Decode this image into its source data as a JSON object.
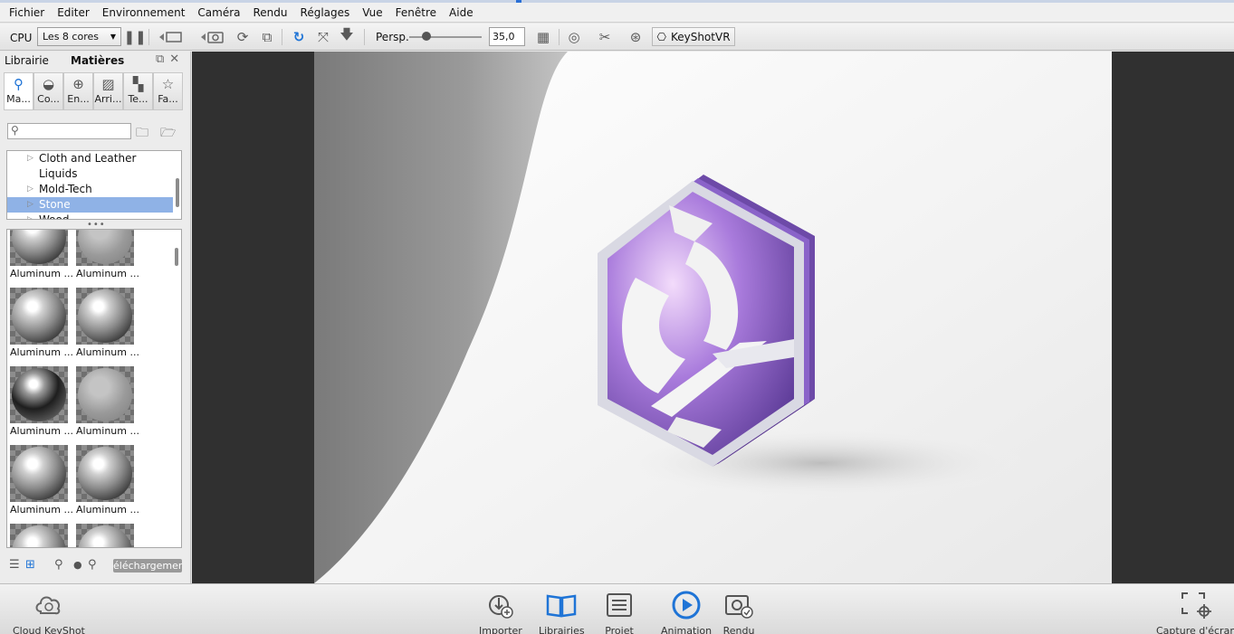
{
  "menubar": [
    "Fichier",
    "Editer",
    "Environnement",
    "Caméra",
    "Rendu",
    "Réglages",
    "Vue",
    "Fenêtre",
    "Aide"
  ],
  "toolbar": {
    "cpu_label": "CPU",
    "cores_value": "Les 8 cores",
    "persp_label": "Persp.",
    "fov_value": "35,0",
    "fov_slider_fraction": 0.2,
    "keyshotvr_label": "KeyShotVR"
  },
  "panel": {
    "library_label": "Librairie",
    "materials_label": "Matières",
    "tabs": [
      {
        "label": "Ma...",
        "icon": "material-icon"
      },
      {
        "label": "Co...",
        "icon": "colors-icon"
      },
      {
        "label": "En...",
        "icon": "globe-icon"
      },
      {
        "label": "Arri...",
        "icon": "image-icon"
      },
      {
        "label": "Te...",
        "icon": "texture-icon"
      },
      {
        "label": "Fa...",
        "icon": "star-icon"
      }
    ],
    "search_placeholder": "",
    "tree": [
      "Cloth and Leather",
      "Liquids",
      "Mold-Tech",
      "Stone",
      "Wood"
    ],
    "materials": [
      "Aluminum ...",
      "Aluminum ...",
      "Aluminum ...",
      "Aluminum ...",
      "Aluminum ...",
      "Aluminum ...",
      "Aluminum ...",
      "Aluminum ...",
      "",
      ""
    ],
    "download_label": "éléchargemen"
  },
  "bottom": {
    "cloud_label": "Cloud KeyShot",
    "import_label": "Importer",
    "libraries_label": "Librairies",
    "project_label": "Projet",
    "animation_label": "Animation",
    "render_label": "Rendu",
    "screenshot_label": "Capture d'écran"
  },
  "colors": {
    "accent": "#1f74d6",
    "logo_purple": "#8a63c9",
    "viewport_bg": "#303030"
  }
}
